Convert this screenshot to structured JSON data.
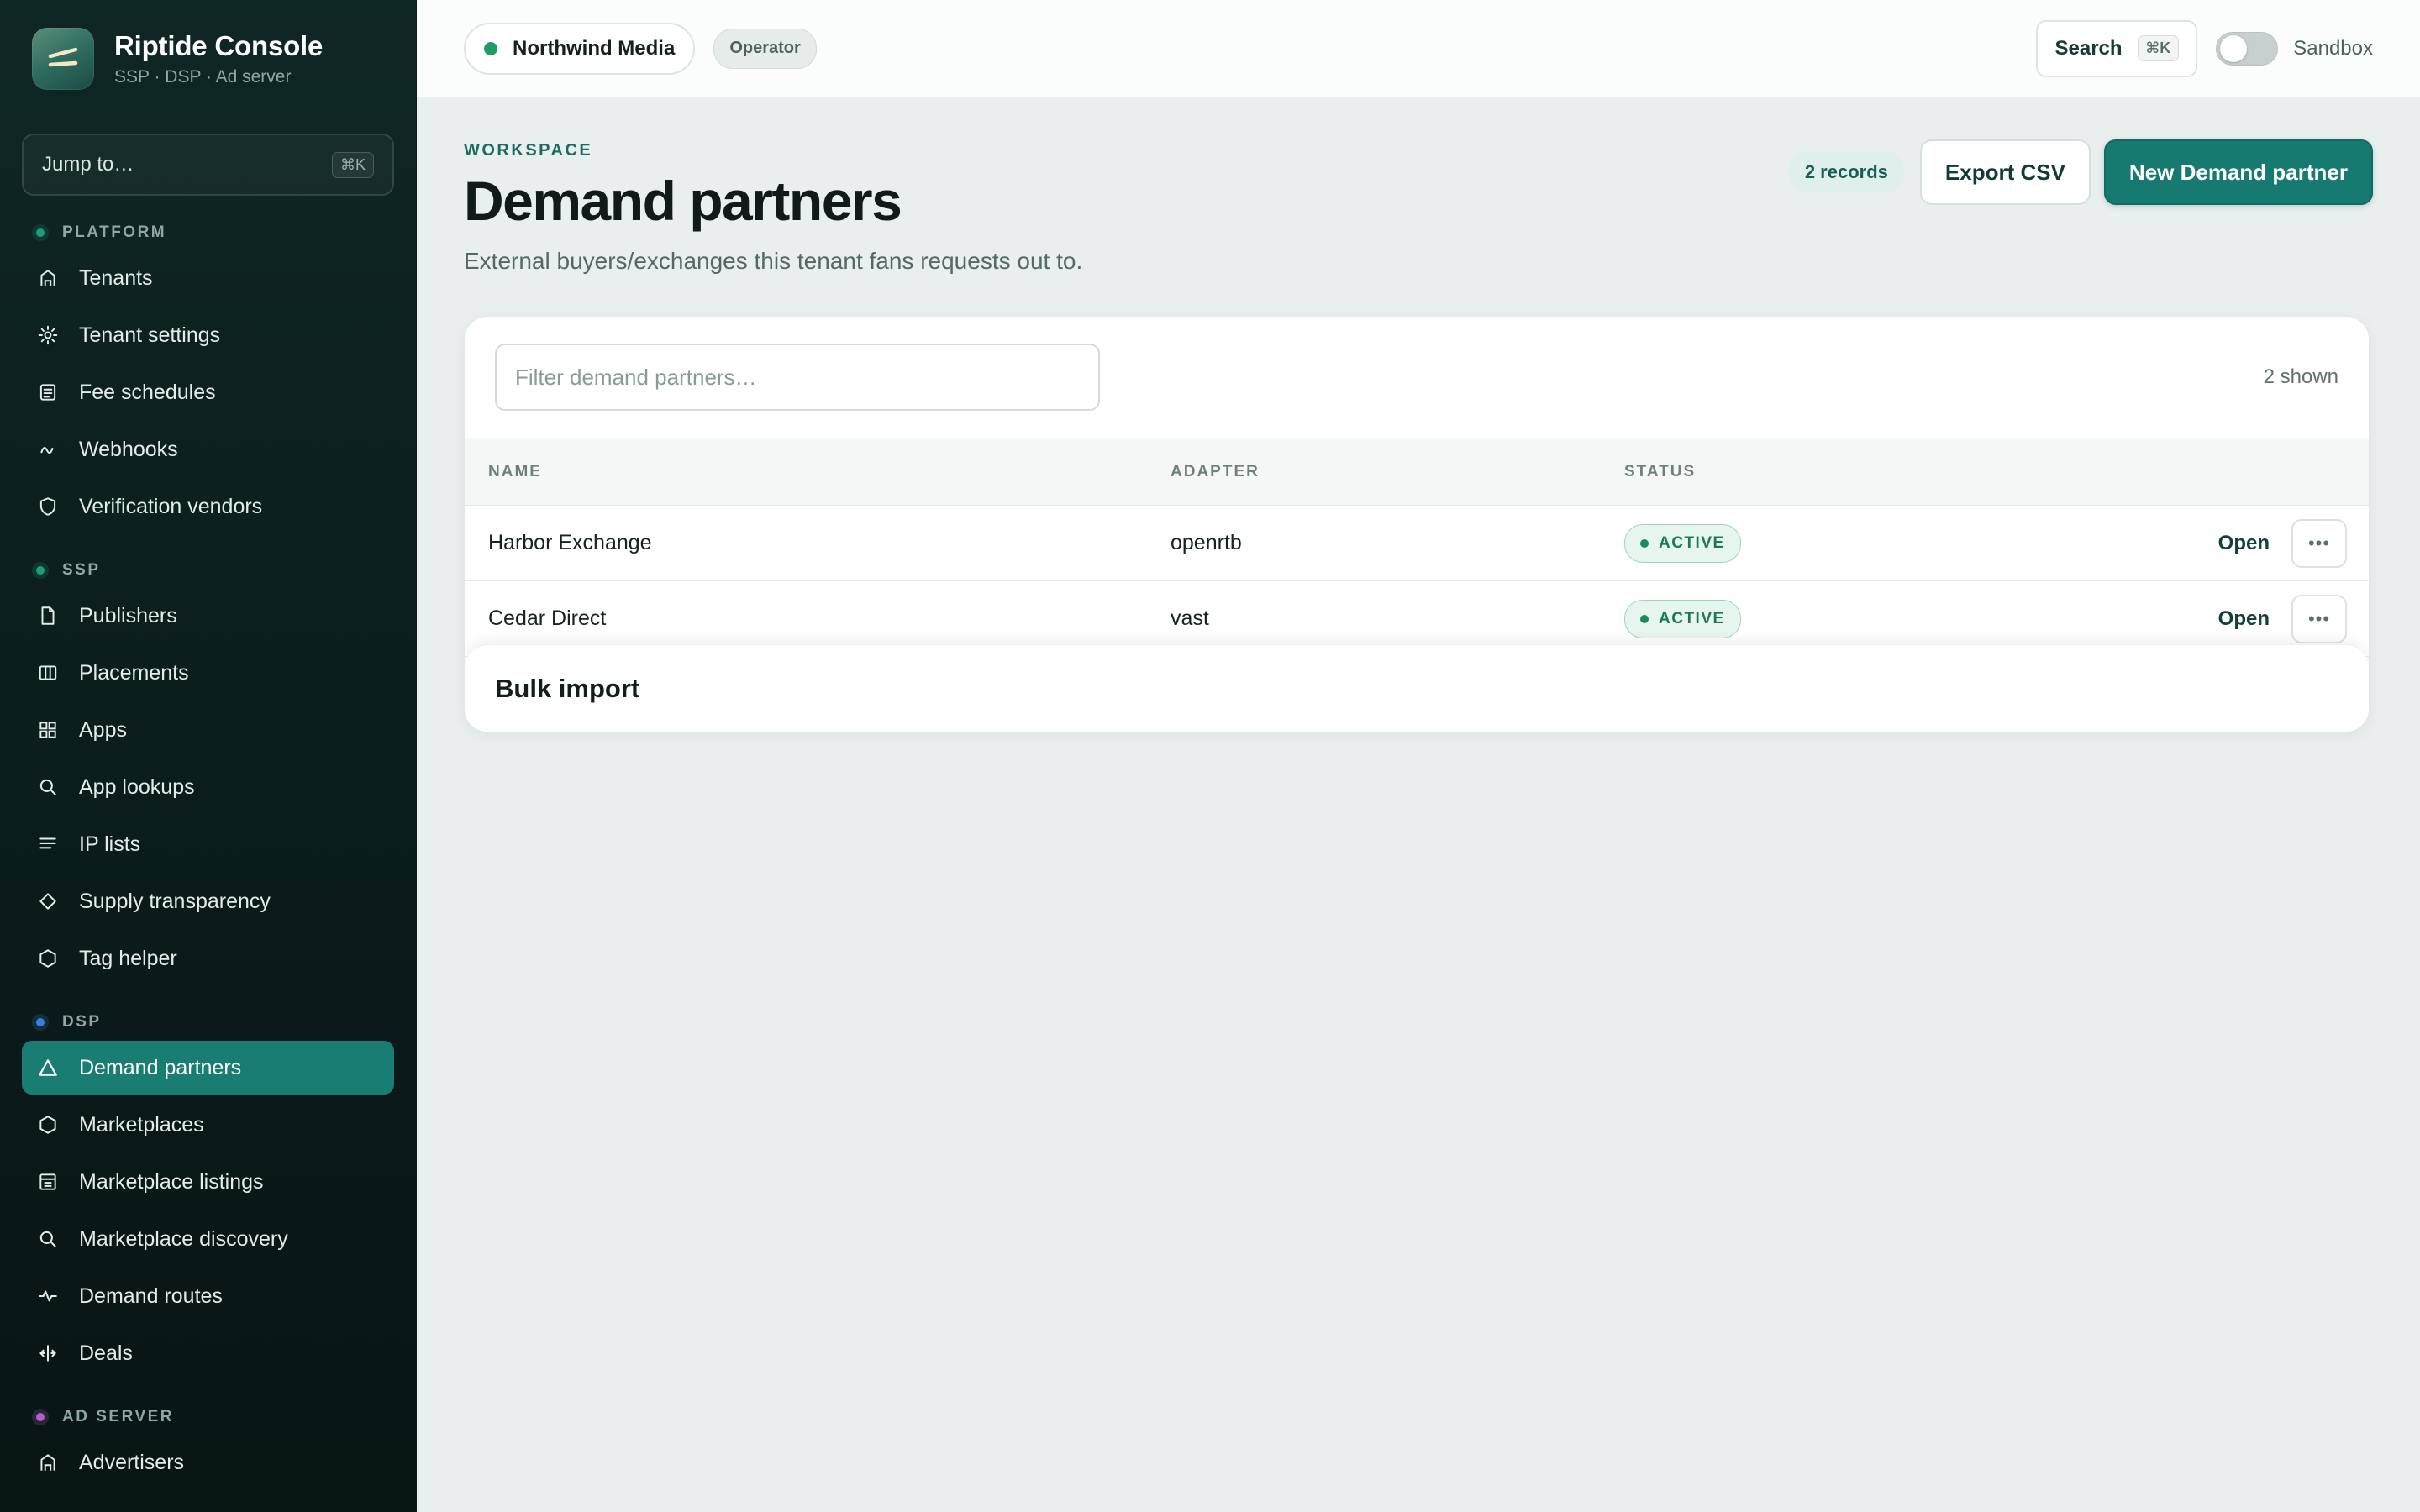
{
  "brand": {
    "title": "Riptide Console",
    "subtitle": "SSP · DSP · Ad server"
  },
  "jump": {
    "label": "Jump to…",
    "shortcut": "⌘K"
  },
  "sidebar": {
    "sections": [
      {
        "label": "PLATFORM",
        "color": "#1f9d7a",
        "items": [
          {
            "label": "Tenants",
            "icon": "building-icon"
          },
          {
            "label": "Tenant settings",
            "icon": "gear-icon"
          },
          {
            "label": "Fee schedules",
            "icon": "document-icon"
          },
          {
            "label": "Webhooks",
            "icon": "webhook-icon"
          },
          {
            "label": "Verification vendors",
            "icon": "shield-icon"
          }
        ]
      },
      {
        "label": "SSP",
        "color": "#1f9d7a",
        "items": [
          {
            "label": "Publishers",
            "icon": "file-icon"
          },
          {
            "label": "Placements",
            "icon": "columns-icon"
          },
          {
            "label": "Apps",
            "icon": "grid-icon"
          },
          {
            "label": "App lookups",
            "icon": "search-icon"
          },
          {
            "label": "IP lists",
            "icon": "list-icon"
          },
          {
            "label": "Supply transparency",
            "icon": "diamond-icon"
          },
          {
            "label": "Tag helper",
            "icon": "hexagon-icon"
          }
        ]
      },
      {
        "label": "DSP",
        "color": "#3b7fd6",
        "items": [
          {
            "label": "Demand partners",
            "icon": "triangle-icon",
            "active": true
          },
          {
            "label": "Marketplaces",
            "icon": "hexagon-icon"
          },
          {
            "label": "Marketplace listings",
            "icon": "listing-icon"
          },
          {
            "label": "Marketplace discovery",
            "icon": "search-icon"
          },
          {
            "label": "Demand routes",
            "icon": "pulse-icon"
          },
          {
            "label": "Deals",
            "icon": "handshake-icon"
          }
        ]
      },
      {
        "label": "AD SERVER",
        "color": "#b35fc9",
        "items": [
          {
            "label": "Advertisers",
            "icon": "building-icon"
          }
        ]
      }
    ]
  },
  "topbar": {
    "tenant": "Northwind Media",
    "role": "Operator",
    "search_label": "Search",
    "search_shortcut": "⌘K",
    "sandbox_label": "Sandbox",
    "sandbox_on": false
  },
  "page": {
    "eyebrow": "WORKSPACE",
    "title": "Demand partners",
    "subtitle": "External buyers/exchanges this tenant fans requests out to.",
    "records_badge": "2 records",
    "export_label": "Export CSV",
    "new_label": "New Demand partner"
  },
  "table": {
    "filter_placeholder": "Filter demand partners…",
    "shown": "2 shown",
    "columns": [
      "NAME",
      "ADAPTER",
      "STATUS"
    ],
    "rows": [
      {
        "name": "Harbor Exchange",
        "adapter": "openrtb",
        "status": "ACTIVE",
        "action": "Open"
      },
      {
        "name": "Cedar Direct",
        "adapter": "vast",
        "status": "ACTIVE",
        "action": "Open"
      }
    ]
  },
  "bulk": {
    "title": "Bulk import"
  },
  "colors": {
    "accent": "#177a70",
    "active_status": "#1c7a52",
    "sidebar_bg": "#0f2724"
  }
}
